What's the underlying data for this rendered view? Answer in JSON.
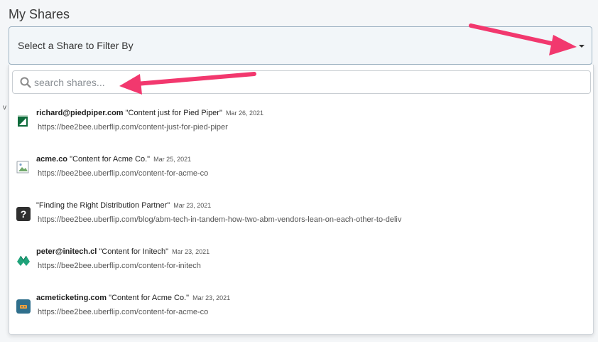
{
  "page": {
    "title": "My Shares"
  },
  "filter": {
    "label": "Select a Share to Filter By",
    "search_placeholder": "search shares..."
  },
  "shares": [
    {
      "domain": "richard@piedpiper.com",
      "title": "\"Content just for Pied Piper\"",
      "date": "Mar 26, 2021",
      "url": "https://bee2bee.uberflip.com/content-just-for-pied-piper",
      "icon": "piedpiper-logo-icon"
    },
    {
      "domain": "acme.co",
      "title": "\"Content for Acme Co.\"",
      "date": "Mar 25, 2021",
      "url": "https://bee2bee.uberflip.com/content-for-acme-co",
      "icon": "broken-image-icon"
    },
    {
      "domain": "",
      "title": "\"Finding the Right Distribution Partner\"",
      "date": "Mar 23, 2021",
      "url": "https://bee2bee.uberflip.com/blog/abm-tech-in-tandem-how-two-abm-vendors-lean-on-each-other-to-deliv",
      "icon": "question-mark-icon"
    },
    {
      "domain": "peter@initech.cl",
      "title": "\"Content for Initech\"",
      "date": "Mar 23, 2021",
      "url": "https://bee2bee.uberflip.com/content-for-initech",
      "icon": "initech-logo-icon"
    },
    {
      "domain": "acmeticketing.com",
      "title": "\"Content for Acme Co.\"",
      "date": "Mar 23, 2021",
      "url": "https://bee2bee.uberflip.com/content-for-acme-co",
      "icon": "acmeticketing-logo-icon"
    }
  ],
  "colors": {
    "annotation_arrow": "#f2386e",
    "select_border": "#9fb4c4"
  }
}
